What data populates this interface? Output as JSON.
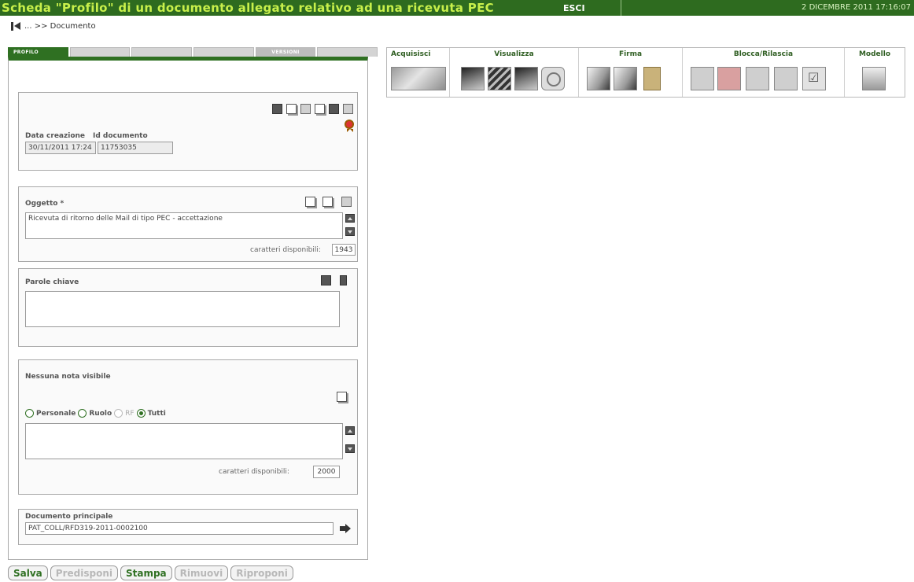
{
  "window": {
    "title": "Scheda \"Profilo\" di un documento allegato relativo ad una ricevuta PEC",
    "esci_label": "ESCI",
    "datetime": "2 DICEMBRE 2011 17:16:07"
  },
  "breadcrumb": {
    "text": "... >> Documento"
  },
  "tabs": [
    {
      "label": "PROFILO",
      "active": true
    },
    {
      "label": "",
      "active": false
    },
    {
      "label": "",
      "active": false
    },
    {
      "label": "",
      "active": false
    },
    {
      "label": "VERSIONI",
      "active": false
    },
    {
      "label": "",
      "active": false
    }
  ],
  "profile": {
    "data_creazione_label": "Data creazione",
    "id_documento_label": "Id documento",
    "data_creazione": "30/11/2011 17:24",
    "id_documento": "11753035"
  },
  "oggetto": {
    "label": "Oggetto *",
    "value": "Ricevuta di ritorno delle Mail di tipo PEC - accettazione",
    "counter_label": "caratteri disponibili:",
    "counter": "1943"
  },
  "parole_chiave": {
    "label": "Parole chiave",
    "value": ""
  },
  "note": {
    "label": "Nessuna nota visibile",
    "radios": [
      {
        "label": "Personale",
        "checked": false,
        "disabled": false
      },
      {
        "label": "Ruolo",
        "checked": false,
        "disabled": false
      },
      {
        "label": "RF",
        "checked": false,
        "disabled": true
      },
      {
        "label": "Tutti",
        "checked": true,
        "disabled": false
      }
    ],
    "value": "",
    "counter_label": "caratteri disponibili:",
    "counter": "2000"
  },
  "documento_principale": {
    "label": "Documento principale",
    "value": "PAT_COLL/RFD319-2011-0002100"
  },
  "buttons": [
    {
      "label": "Salva",
      "enabled": true
    },
    {
      "label": "Predisponi",
      "enabled": false
    },
    {
      "label": "Stampa",
      "enabled": true
    },
    {
      "label": "Rimuovi",
      "enabled": false
    },
    {
      "label": "Riproponi",
      "enabled": false
    }
  ],
  "toolbar": {
    "groups": [
      "Acquisisci",
      "Visualizza",
      "Firma",
      "Blocca/Rilascia",
      "Modello"
    ]
  },
  "colors": {
    "brand_green": "#2e6b1f",
    "title_text": "#c8f04b"
  }
}
